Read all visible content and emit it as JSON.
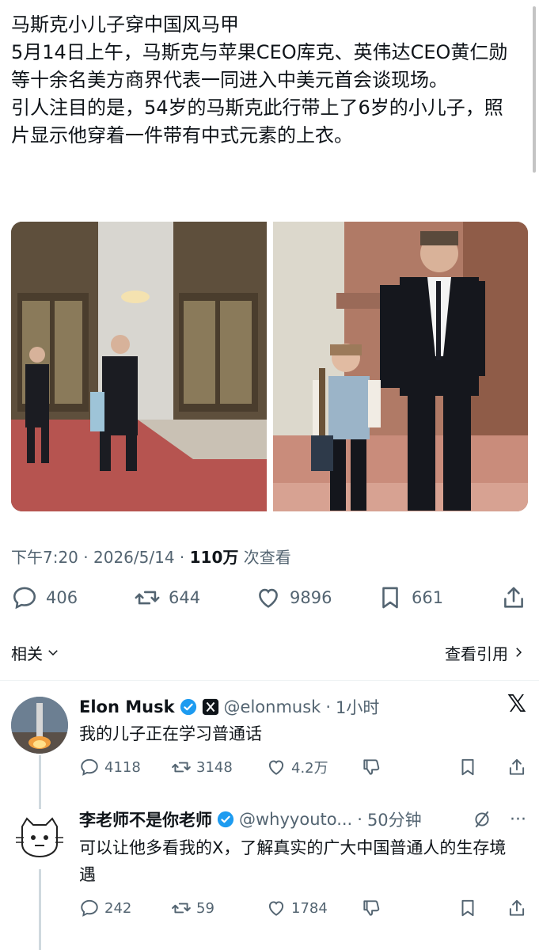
{
  "post": {
    "title": "马斯克小儿子穿中国风马甲",
    "paragraph1": "5月14日上午，马斯克与苹果CEO库克、英伟达CEO黄仁勋等十余名美方商界代表一同进入中美元首会谈现场。",
    "paragraph2": "引人注目的是，54岁的马斯克此行带上了6岁的小儿子，照片显示他穿着一件带有中式元素的上衣。",
    "time": "下午7:20",
    "date": "2026/5/14",
    "views_count": "110万",
    "views_label": "次查看"
  },
  "actions": {
    "replies": "406",
    "reposts": "644",
    "likes": "9896",
    "bookmarks": "661"
  },
  "related": {
    "left_label": "相关",
    "right_label": "查看引用"
  },
  "replies": [
    {
      "name": "Elon Musk",
      "handle": "@elonmusk",
      "time": "1小时",
      "text": "我的儿子正在学习普通话",
      "replies": "4118",
      "reposts": "3148",
      "likes": "4.2万"
    },
    {
      "name": "李老师不是你老师",
      "handle": "@whyyouto...",
      "time": "50分钟",
      "text": "可以让他多看我的X，了解真实的广大中国普通人的生存境遇",
      "replies": "242",
      "reposts": "59",
      "likes": "1784"
    }
  ],
  "colors": {
    "text_primary": "#0f1419",
    "text_secondary": "#536471",
    "verified": "#1d9bf0",
    "divider": "#eff3f4"
  }
}
